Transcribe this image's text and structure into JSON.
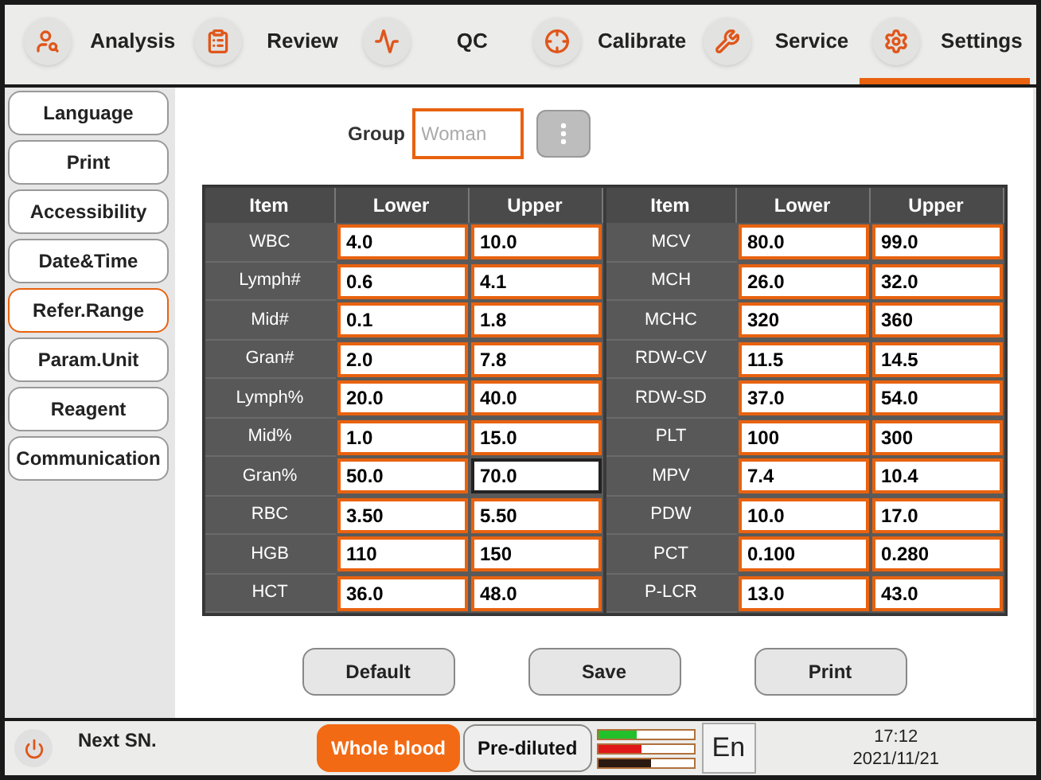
{
  "nav": [
    {
      "label": "Analysis",
      "kind": "analysis",
      "selected": false
    },
    {
      "label": "Review",
      "kind": "review",
      "selected": false
    },
    {
      "label": "QC",
      "kind": "qc",
      "selected": false
    },
    {
      "label": "Calibrate",
      "kind": "calibrate",
      "selected": false
    },
    {
      "label": "Service",
      "kind": "service",
      "selected": false
    },
    {
      "label": "Settings",
      "kind": "settings",
      "selected": true
    }
  ],
  "sidebar": {
    "items": [
      {
        "label": "Language",
        "selected": false
      },
      {
        "label": "Print",
        "selected": false
      },
      {
        "label": "Accessibility",
        "selected": false
      },
      {
        "label": "Date&Time",
        "selected": false
      },
      {
        "label": "Refer.Range",
        "selected": true
      },
      {
        "label": "Param.Unit",
        "selected": false
      },
      {
        "label": "Reagent",
        "selected": false
      },
      {
        "label": "Communication",
        "selected": false
      }
    ]
  },
  "group": {
    "label": "Group",
    "placeholder": "Woman"
  },
  "table": {
    "columns": [
      "Item",
      "Lower",
      "Upper",
      "Item",
      "Lower",
      "Upper"
    ],
    "left_rows": [
      {
        "item": "WBC",
        "lower": {
          "value": "4.0",
          "focused": false
        },
        "upper": {
          "value": "10.0",
          "focused": false
        }
      },
      {
        "item": "Lymph#",
        "lower": {
          "value": "0.6",
          "focused": false
        },
        "upper": {
          "value": "4.1",
          "focused": false
        }
      },
      {
        "item": "Mid#",
        "lower": {
          "value": "0.1",
          "focused": false
        },
        "upper": {
          "value": "1.8",
          "focused": false
        }
      },
      {
        "item": "Gran#",
        "lower": {
          "value": "2.0",
          "focused": false
        },
        "upper": {
          "value": "7.8",
          "focused": false
        }
      },
      {
        "item": "Lymph%",
        "lower": {
          "value": "20.0",
          "focused": false
        },
        "upper": {
          "value": "40.0",
          "focused": false
        }
      },
      {
        "item": "Mid%",
        "lower": {
          "value": "1.0",
          "focused": false
        },
        "upper": {
          "value": "15.0",
          "focused": false
        }
      },
      {
        "item": "Gran%",
        "lower": {
          "value": "50.0",
          "focused": false
        },
        "upper": {
          "value": "70.0",
          "focused": true
        }
      },
      {
        "item": "RBC",
        "lower": {
          "value": "3.50",
          "focused": false
        },
        "upper": {
          "value": "5.50",
          "focused": false
        }
      },
      {
        "item": "HGB",
        "lower": {
          "value": "110",
          "focused": false
        },
        "upper": {
          "value": "150",
          "focused": false
        }
      },
      {
        "item": "HCT",
        "lower": {
          "value": "36.0",
          "focused": false
        },
        "upper": {
          "value": "48.0",
          "focused": false
        }
      }
    ],
    "right_rows": [
      {
        "item": "MCV",
        "lower": {
          "value": "80.0",
          "focused": false
        },
        "upper": {
          "value": "99.0",
          "focused": false
        }
      },
      {
        "item": "MCH",
        "lower": {
          "value": "26.0",
          "focused": false
        },
        "upper": {
          "value": "32.0",
          "focused": false
        }
      },
      {
        "item": "MCHC",
        "lower": {
          "value": "320",
          "focused": false
        },
        "upper": {
          "value": "360",
          "focused": false
        }
      },
      {
        "item": "RDW-CV",
        "lower": {
          "value": "11.5",
          "focused": false
        },
        "upper": {
          "value": "14.5",
          "focused": false
        }
      },
      {
        "item": "RDW-SD",
        "lower": {
          "value": "37.0",
          "focused": false
        },
        "upper": {
          "value": "54.0",
          "focused": false
        }
      },
      {
        "item": "PLT",
        "lower": {
          "value": "100",
          "focused": false
        },
        "upper": {
          "value": "300",
          "focused": false
        }
      },
      {
        "item": "MPV",
        "lower": {
          "value": "7.4",
          "focused": false
        },
        "upper": {
          "value": "10.4",
          "focused": false
        }
      },
      {
        "item": "PDW",
        "lower": {
          "value": "10.0",
          "focused": false
        },
        "upper": {
          "value": "17.0",
          "focused": false
        }
      },
      {
        "item": "PCT",
        "lower": {
          "value": "0.100",
          "focused": false
        },
        "upper": {
          "value": "0.280",
          "focused": false
        }
      },
      {
        "item": "P-LCR",
        "lower": {
          "value": "13.0",
          "focused": false
        },
        "upper": {
          "value": "43.0",
          "focused": false
        }
      }
    ]
  },
  "buttons": [
    "Default",
    "Save",
    "Print"
  ],
  "status_bar": {
    "next_sn": "Next SN.",
    "modes": [
      {
        "label": "Whole blood",
        "selected": true
      },
      {
        "label": "Pre-diluted",
        "selected": false
      }
    ],
    "reagents": [
      {
        "level": 0.4,
        "color": "#22c02a"
      },
      {
        "level": 0.45,
        "color": "#e01818"
      },
      {
        "level": 0.55,
        "color": "#2a1a12"
      }
    ],
    "language": "En",
    "time": "17:12",
    "date": "2021/11/21"
  }
}
